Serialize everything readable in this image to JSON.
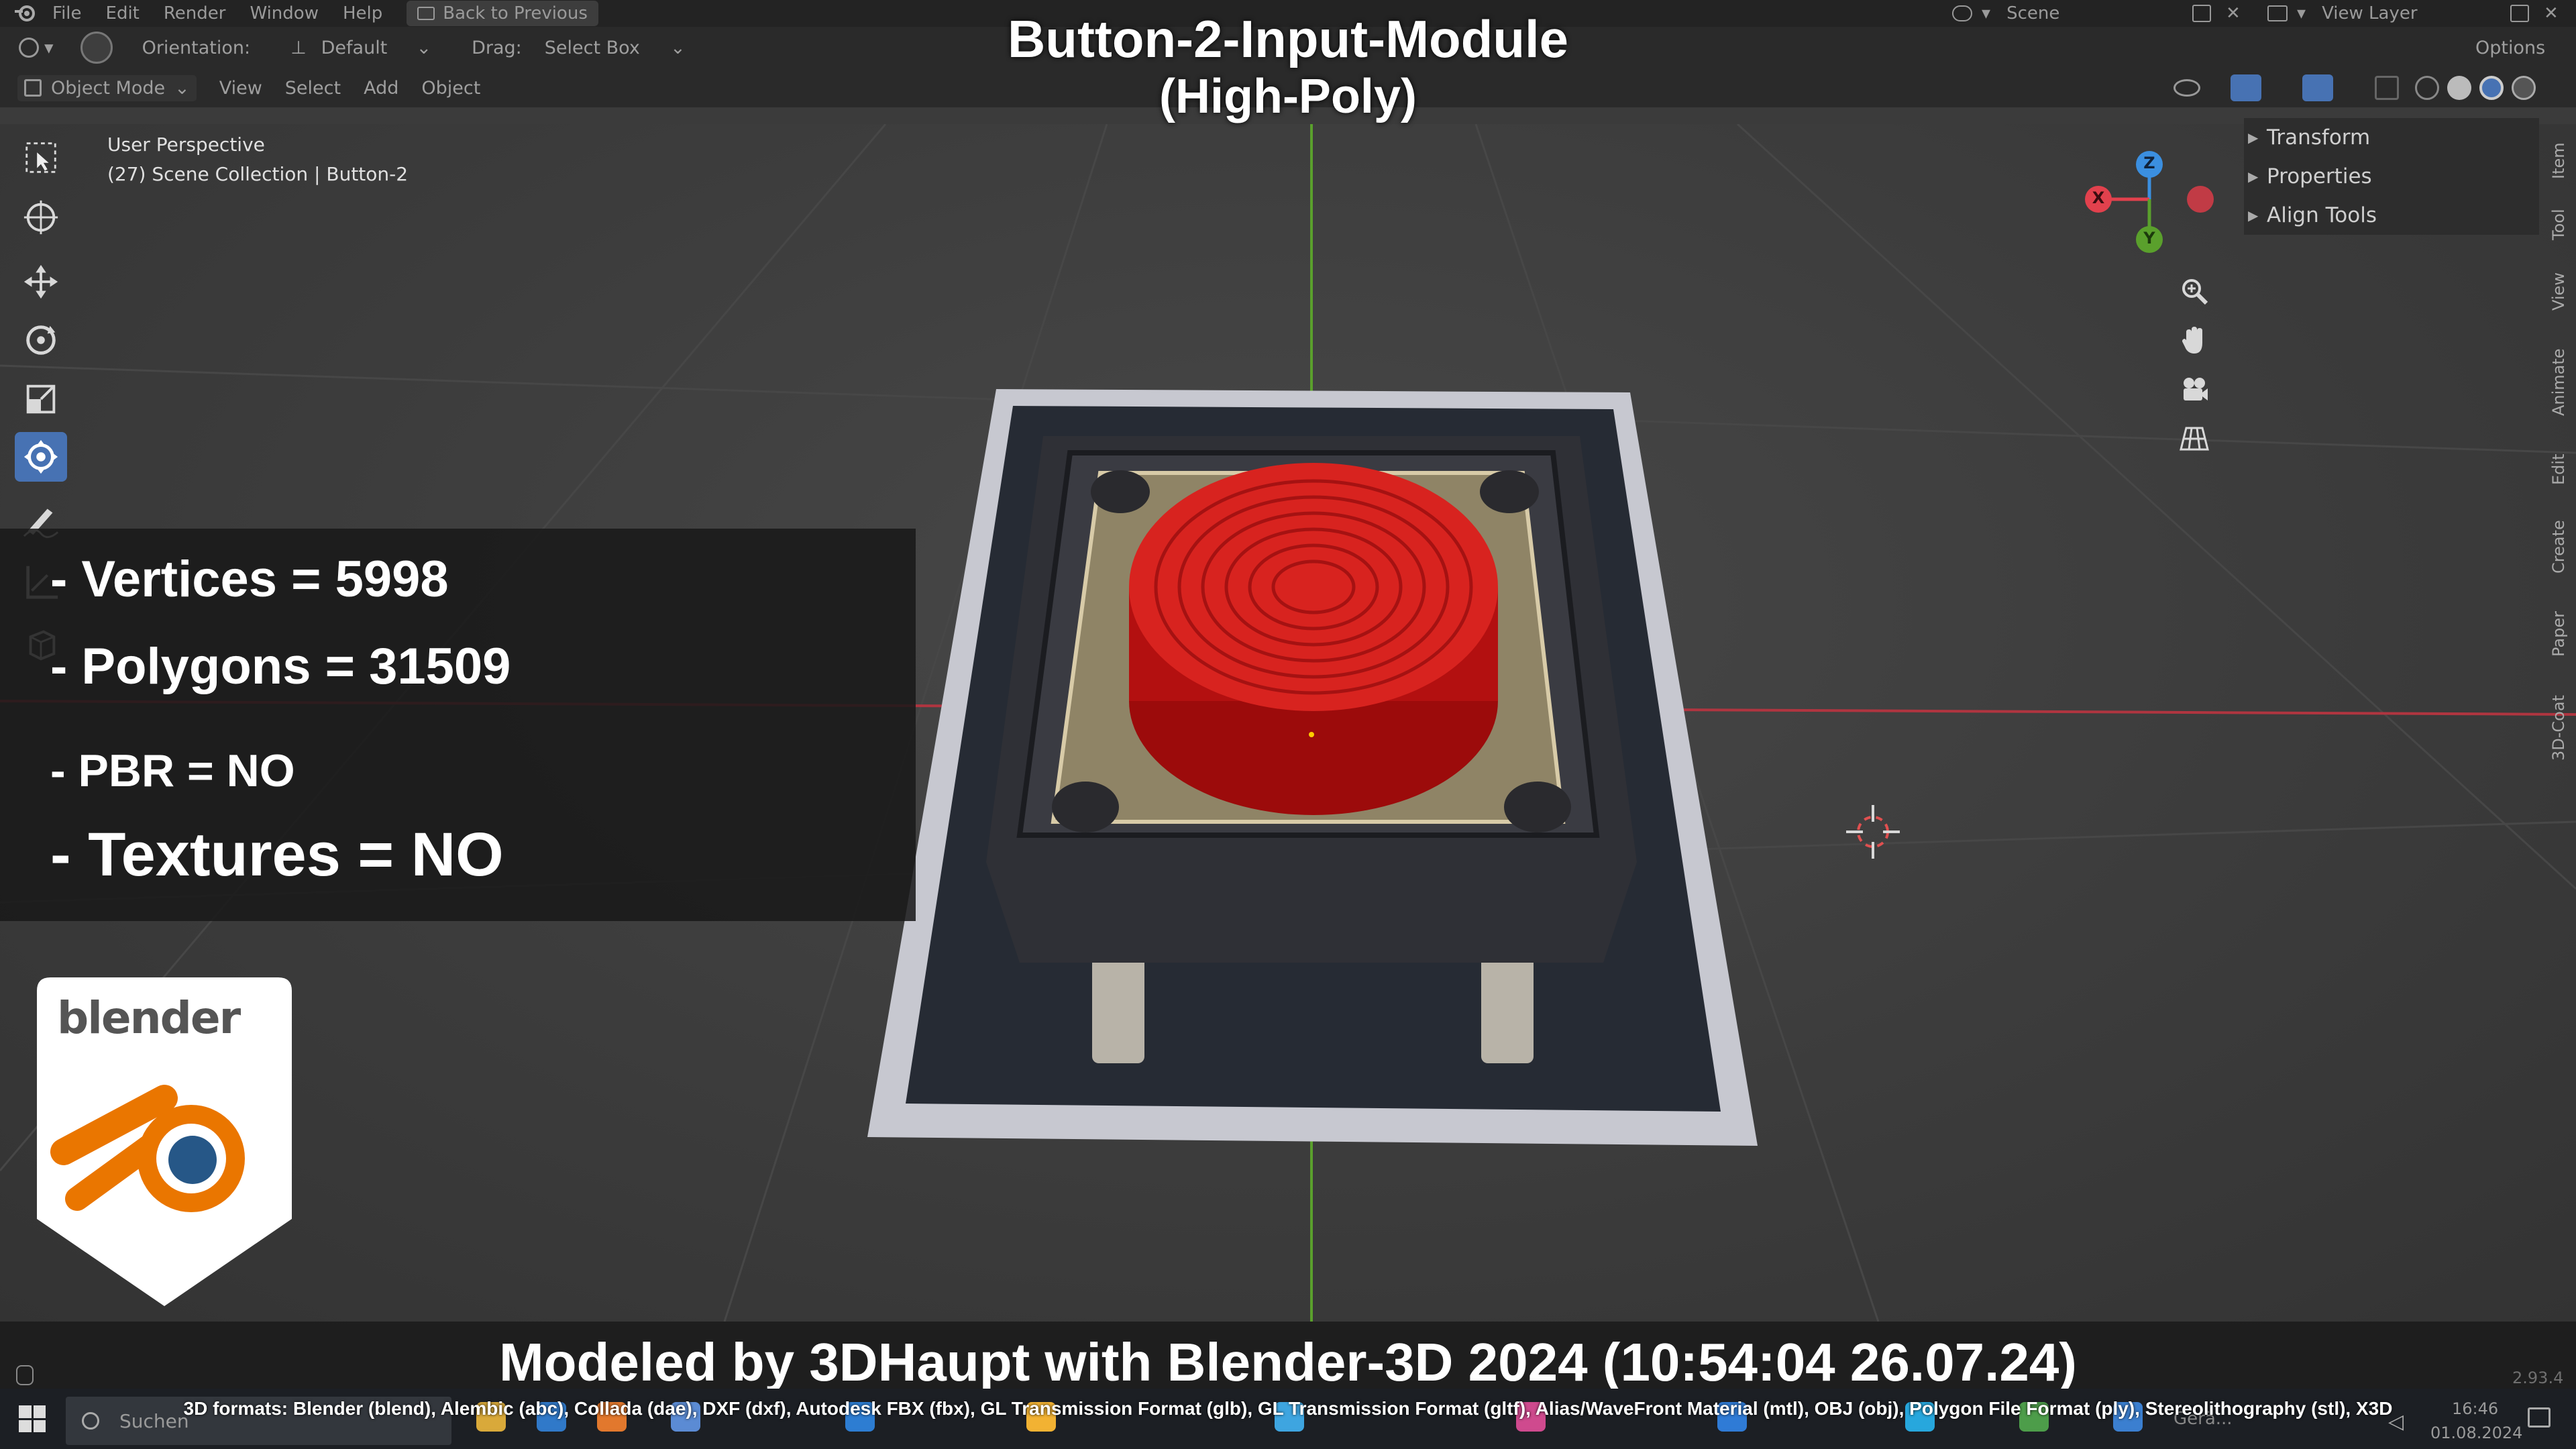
{
  "menu": {
    "items": [
      "File",
      "Edit",
      "Render",
      "Window",
      "Help"
    ],
    "back_to_previous": "Back to Previous",
    "scene": "Scene",
    "view_layer": "View Layer",
    "options": "Options"
  },
  "header": {
    "orientation_label": "Orientation:",
    "orientation_value": "Default",
    "drag_label": "Drag:",
    "drag_value": "Select Box",
    "mode": "Object Mode",
    "menus": [
      "View",
      "Select",
      "Add",
      "Object"
    ]
  },
  "viewport": {
    "perspective": "User Perspective",
    "collection": "(27) Scene Collection | Button-2"
  },
  "gizmo": {
    "x": "X",
    "y": "Y",
    "z": "Z"
  },
  "npanel": {
    "sections": [
      "Transform",
      "Properties",
      "Align Tools"
    ],
    "tabs": [
      "Item",
      "Tool",
      "View",
      "Animate",
      "Edit",
      "Create",
      "Paper",
      "3D-Coat"
    ]
  },
  "title": {
    "line1": "Button-2-Input-Module",
    "line2": "(High-Poly)"
  },
  "stats": {
    "vertices": "- Vertices = 5998",
    "polygons": "- Polygons = 31509",
    "pbr": "- PBR =  NO",
    "textures": "- Textures = NO"
  },
  "logo": {
    "text": "blender"
  },
  "footer": {
    "credit": "Modeled by 3DHaupt with Blender-3D 2024 (10:54:04  26.07.24)",
    "formats": "3D formats: Blender (blend), Alembic (abc), Collada (dae), DXF (dxf), Autodesk FBX (fbx), GL Transmission Format (glb), GL Transmission Format (gltf), Alias/WaveFront Material (mtl), OBJ (obj), Polygon File Format (ply), Stereolithography (stl), X3D",
    "version": "2.93.4"
  },
  "taskbar": {
    "search": "Suchen",
    "time": "16:46",
    "date": "01.08.2024",
    "app_label": "Gerä..."
  },
  "colors": {
    "accent": "#4772b3",
    "axis_x": "#e2414d",
    "axis_y": "#5aa02c",
    "axis_z": "#3b8fe0",
    "blender_orange": "#ea7600",
    "blender_blue": "#265787"
  }
}
